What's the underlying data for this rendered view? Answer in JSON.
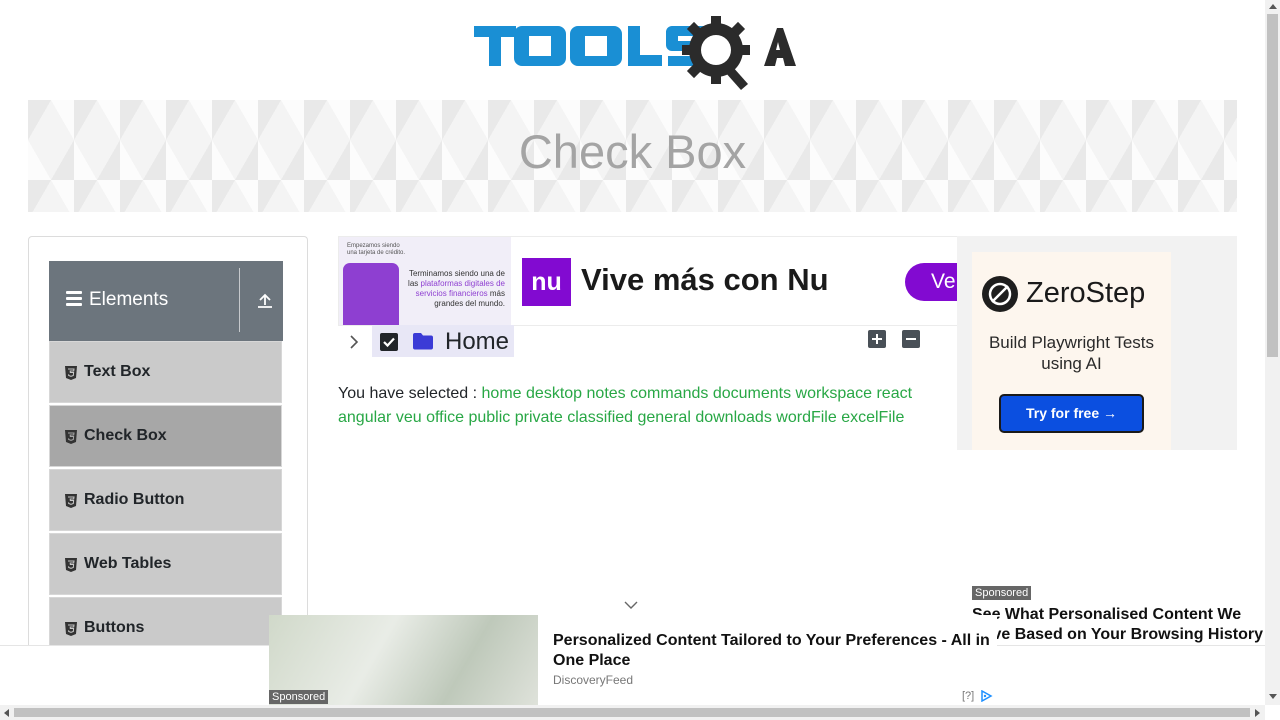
{
  "header": {
    "logo_text": "TOOLSQA",
    "page_title": "Check Box"
  },
  "sidebar": {
    "group_title": "Elements",
    "items": [
      {
        "label": "Text Box"
      },
      {
        "label": "Check Box",
        "active": true
      },
      {
        "label": "Radio Button"
      },
      {
        "label": "Web Tables"
      },
      {
        "label": "Buttons"
      }
    ]
  },
  "ad_top": {
    "small_text": "Empezamos siendo una tarjeta de crédito.",
    "body_text_1": "Terminamos siendo una de las ",
    "body_text_hl": "plataformas digitales de servicios financieros",
    "body_text_2": " más grandes del mundo.",
    "brand": "nu",
    "headline": "Vive más con Nu",
    "cta": "Ve"
  },
  "tree": {
    "root_label": "Home",
    "checked": true
  },
  "result": {
    "prefix": "You have selected :",
    "selected": [
      "home",
      "desktop",
      "notes",
      "commands",
      "documents",
      "workspace",
      "react",
      "angular",
      "veu",
      "office",
      "public",
      "private",
      "classified",
      "general",
      "downloads",
      "wordFile",
      "excelFile"
    ]
  },
  "ad_right": {
    "brand": "ZeroStep",
    "tagline": "Build Playwright Tests using AI",
    "cta": "Try for free →",
    "sponsored": "Sponsored",
    "headline": "See What Personalised Content We Have Based on Your Browsing History"
  },
  "ad_bottom": {
    "sponsored": "Sponsored",
    "headline": "Personalized Content Tailored to Your Preferences - All in One Place",
    "source": "DiscoveryFeed",
    "adchoices": "[?]"
  },
  "colors": {
    "accent_green": "#28a745",
    "sidebar_header": "#6c757d",
    "nu_purple": "#820ad1",
    "zerostep_blue": "#0b4fe0"
  }
}
